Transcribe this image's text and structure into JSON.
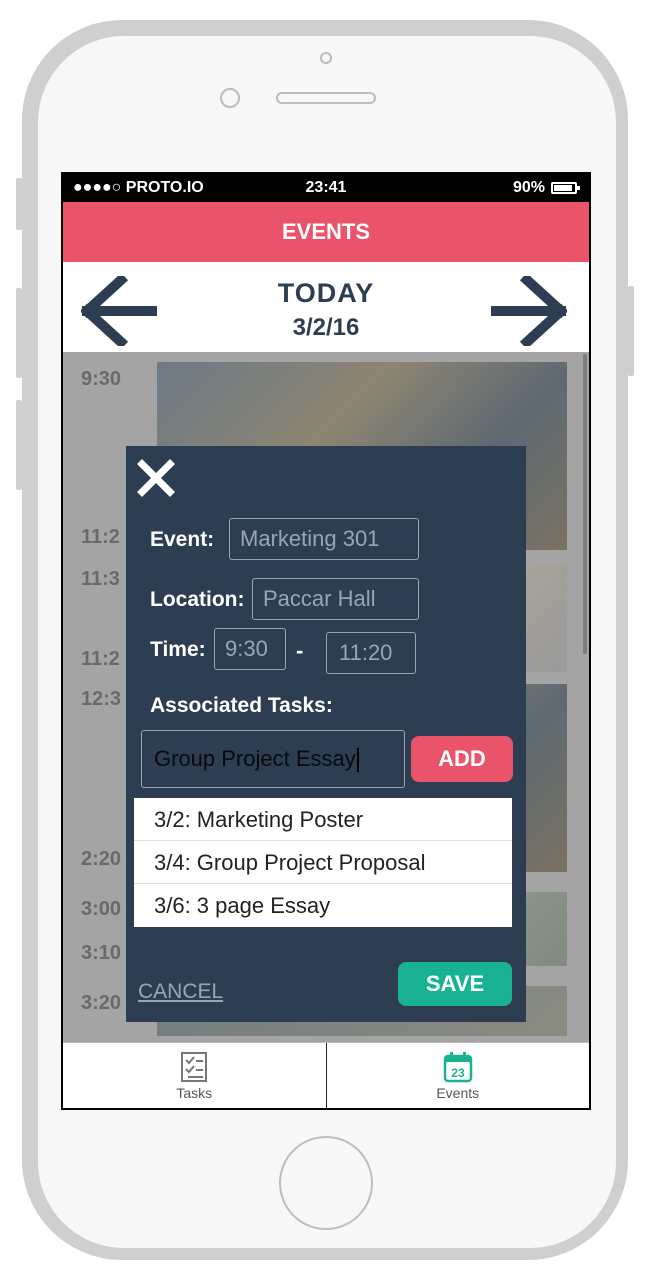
{
  "status": {
    "carrier": "●●●●○ PROTO.IO",
    "time": "23:41",
    "battery": "90%"
  },
  "header": {
    "title": "EVENTS"
  },
  "date_nav": {
    "label": "TODAY",
    "date": "3/2/16",
    "prev_icon": "arrow-left-icon",
    "next_icon": "arrow-right-icon"
  },
  "schedule": {
    "times": [
      "9:30",
      "11:2",
      "11:3",
      "11:2",
      "12:3",
      "2:20",
      "3:00",
      "3:10",
      "3:20"
    ]
  },
  "modal": {
    "close_icon": "close-icon",
    "event_label": "Event:",
    "event_value": "Marketing 301",
    "location_label": "Location:",
    "location_value": "Paccar Hall",
    "time_label": "Time:",
    "time_start": "9:30",
    "time_separator": "-",
    "time_end": "11:20",
    "tasks_label": "Associated Tasks:",
    "task_input_value": "Group Project Essay",
    "add_label": "ADD",
    "tasks": [
      "3/2: Marketing Poster",
      "3/4: Group Project Proposal",
      "3/6: 3 page Essay"
    ],
    "cancel_label": "CANCEL",
    "save_label": "SAVE"
  },
  "tabbar": {
    "tabs": [
      {
        "label": "Tasks",
        "icon": "checklist-icon"
      },
      {
        "label": "Events",
        "icon": "calendar-icon",
        "icon_text": "23",
        "active": true
      }
    ]
  },
  "colors": {
    "header": "#e9546b",
    "navy": "#2d3e53",
    "save": "#19b393",
    "add": "#e9546b",
    "active_tab": "#19b393"
  }
}
